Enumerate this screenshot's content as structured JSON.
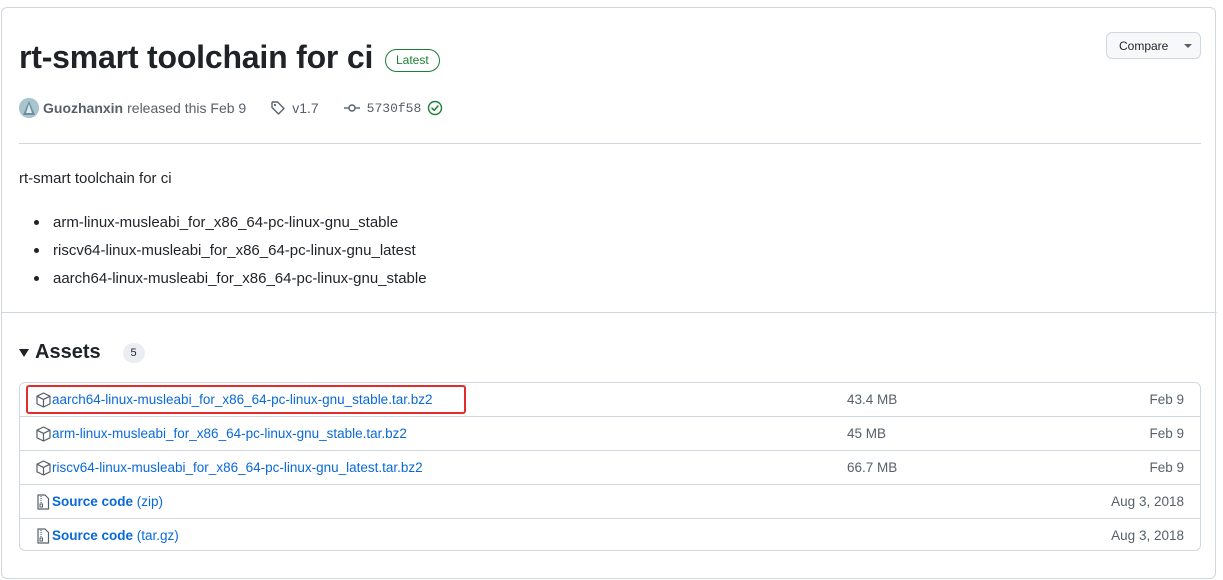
{
  "release": {
    "title": "rt-smart toolchain for ci",
    "badge": "Latest",
    "compare_label": "Compare",
    "author": "Guozhanxin",
    "released_text": "released this Feb 9",
    "tag": "v1.7",
    "commit": "5730f58"
  },
  "notes": {
    "intro": "rt-smart toolchain for ci",
    "items": [
      "arm-linux-musleabi_for_x86_64-pc-linux-gnu_stable",
      "riscv64-linux-musleabi_for_x86_64-pc-linux-gnu_latest",
      "aarch64-linux-musleabi_for_x86_64-pc-linux-gnu_stable"
    ]
  },
  "assets": {
    "title": "Assets",
    "count": "5",
    "rows": [
      {
        "name": "aarch64-linux-musleabi_for_x86_64-pc-linux-gnu_stable.tar.bz2",
        "sub": "",
        "size": "43.4 MB",
        "date": "Feb 9",
        "icon": "package-icon"
      },
      {
        "name": "arm-linux-musleabi_for_x86_64-pc-linux-gnu_stable.tar.bz2",
        "sub": "",
        "size": "45 MB",
        "date": "Feb 9",
        "icon": "package-icon"
      },
      {
        "name": "riscv64-linux-musleabi_for_x86_64-pc-linux-gnu_latest.tar.bz2",
        "sub": "",
        "size": "66.7 MB",
        "date": "Feb 9",
        "icon": "package-icon"
      },
      {
        "name": "Source code",
        "sub": "(zip)",
        "size": "",
        "date": "Aug 3, 2018",
        "icon": "file-zip-icon"
      },
      {
        "name": "Source code",
        "sub": "(tar.gz)",
        "size": "",
        "date": "Aug 3, 2018",
        "icon": "file-zip-icon"
      }
    ]
  },
  "colors": {
    "link": "#0969da",
    "badge_green": "#1a7f37",
    "highlight_red": "#e32d2d",
    "border": "#d0d7de"
  }
}
